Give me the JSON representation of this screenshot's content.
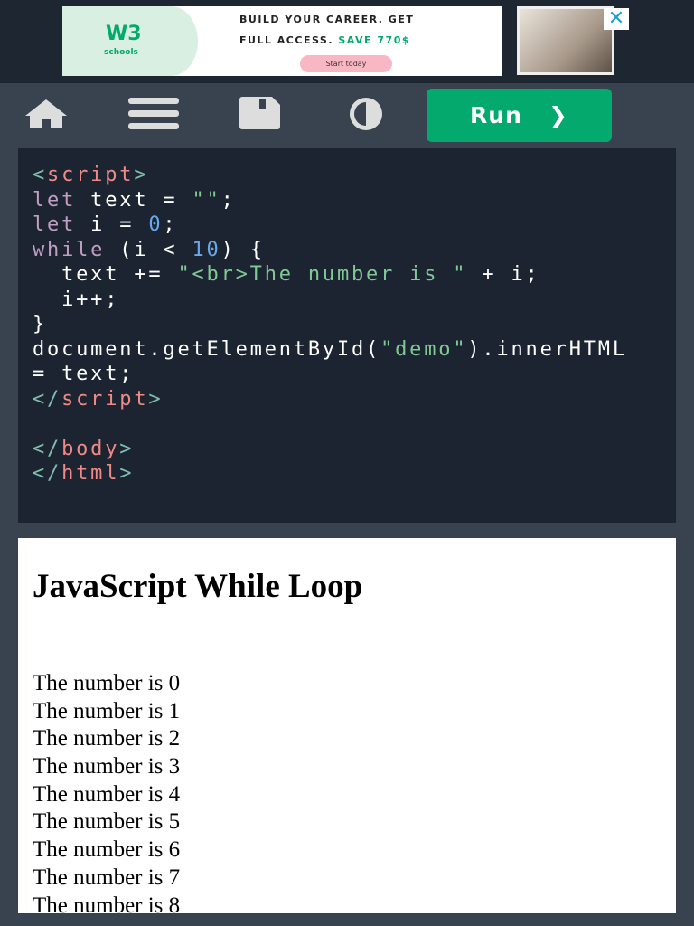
{
  "ad": {
    "logo_mark": "W3",
    "logo_text": "schools",
    "line1": "BUILD YOUR CAREER. GET",
    "line2": "FULL ACCESS.",
    "line2_highlight": "SAVE 770$",
    "button": "Start today",
    "close": "✕"
  },
  "toolbar": {
    "run_label": "Run",
    "run_chevron": "❯"
  },
  "colors": {
    "accent": "#04aa6d",
    "code_bg": "#1b2430",
    "page_bg": "#38434f"
  },
  "code": {
    "l1": [
      "<",
      "script",
      ">"
    ],
    "l2": [
      "let",
      " text = ",
      "\"\"",
      ";"
    ],
    "l3": [
      "let",
      " i = ",
      "0",
      ";"
    ],
    "l4": [
      "while",
      " (i < ",
      "10",
      ") {"
    ],
    "l5": [
      "  text += ",
      "\"<br>The number is \"",
      " + i;"
    ],
    "l6": "  i++;",
    "l7": "}",
    "l8": [
      "document.getElementById(",
      "\"demo\"",
      ").innerHTML"
    ],
    "l9": "= text;",
    "l10": [
      "</",
      "script",
      ">"
    ],
    "l12": [
      "</",
      "body",
      ">"
    ],
    "l13": [
      "</",
      "html",
      ">"
    ]
  },
  "output": {
    "heading": "JavaScript While Loop",
    "lines": [
      "The number is 0",
      "The number is 1",
      "The number is 2",
      "The number is 3",
      "The number is 4",
      "The number is 5",
      "The number is 6",
      "The number is 7",
      "The number is 8"
    ]
  }
}
